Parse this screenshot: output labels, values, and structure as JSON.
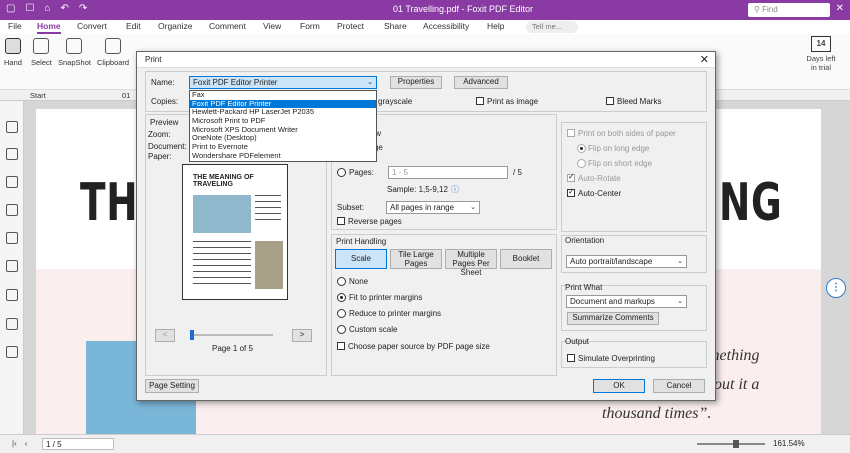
{
  "app": {
    "title": "01 Travelling.pdf - Foxit PDF Editor",
    "search_placeholder": "Find",
    "tell_me": "Tell me...",
    "quick_access": [
      "▢",
      "☐",
      "⌂",
      "↶",
      "↷"
    ],
    "window_controls": [
      "—",
      "□",
      "✕"
    ]
  },
  "menu": {
    "tabs": [
      "File",
      "Home",
      "Convert",
      "Edit",
      "Organize",
      "Comment",
      "View",
      "Form",
      "Protect",
      "Share",
      "Accessibility",
      "Help"
    ],
    "active": "Home"
  },
  "ribbon": {
    "tools": [
      "Hand",
      "Select",
      "SnapShot",
      "Clipboard"
    ],
    "trial_days": "14",
    "trial_label_1": "Days left",
    "trial_label_2": "in trial"
  },
  "doc_tabs": {
    "start": "Start",
    "doc": "01"
  },
  "page": {
    "title_left": "TH",
    "title_right": "NG",
    "quote_lines": [
      "mething",
      "bout it a",
      "thousand times”."
    ]
  },
  "status": {
    "page_value": "1 / 5",
    "zoom": "161.54%"
  },
  "dialog": {
    "title": "Print",
    "name_label": "Name:",
    "copies_label": "Copies:",
    "printer_selected": "Foxit PDF Editor Printer",
    "printers": [
      "Fax",
      "Foxit PDF Editor Printer",
      "Hewlett-Packard HP LaserJet P2035",
      "Microsoft Print to PDF",
      "Microsoft XPS Document Writer",
      "OneNote (Desktop)",
      "Print to Evernote",
      "Wondershare PDFelement"
    ],
    "properties_btn": "Properties",
    "advanced_btn": "Advanced",
    "grayscale_label": "grayscale",
    "print_as_image": "Print as image",
    "bleed_marks": "Bleed Marks",
    "preview": {
      "heading": "Preview",
      "zoom_label": "Zoom:",
      "document_label": "Document:",
      "paper_label": "Paper:",
      "page_title": "THE MEANING OF TRAVELING",
      "page_indicator": "Page 1 of 5",
      "prev": "<",
      "next": ">"
    },
    "range": {
      "view": "view",
      "page": "page",
      "pages_label": "Pages:",
      "pages_placeholder": "1 - 5",
      "pages_total": "/ 5",
      "sample": "Sample: 1,5-9,12",
      "subset_label": "Subset:",
      "subset_value": "All pages in range",
      "reverse": "Reverse pages"
    },
    "handling": {
      "heading": "Print Handling",
      "tabs": [
        "Scale",
        "Tile Large Pages",
        "Multiple Pages Per Sheet",
        "Booklet"
      ],
      "options": [
        "None",
        "Fit to printer margins",
        "Reduce to printer margins",
        "Custom scale"
      ],
      "paper_source": "Choose paper source by PDF page size"
    },
    "duplex": {
      "both_sides": "Print on both sides of paper",
      "long_edge": "Flip on long edge",
      "short_edge": "Flip on short edge",
      "auto_rotate": "Auto-Rotate",
      "auto_center": "Auto-Center"
    },
    "orientation": {
      "heading": "Orientation",
      "value": "Auto portrait/landscape"
    },
    "print_what": {
      "heading": "Print What",
      "value": "Document and markups",
      "summarize": "Summarize Comments"
    },
    "output": {
      "heading": "Output",
      "simulate": "Simulate Overprinting"
    },
    "page_setting": "Page Setting",
    "ok": "OK",
    "cancel": "Cancel"
  }
}
